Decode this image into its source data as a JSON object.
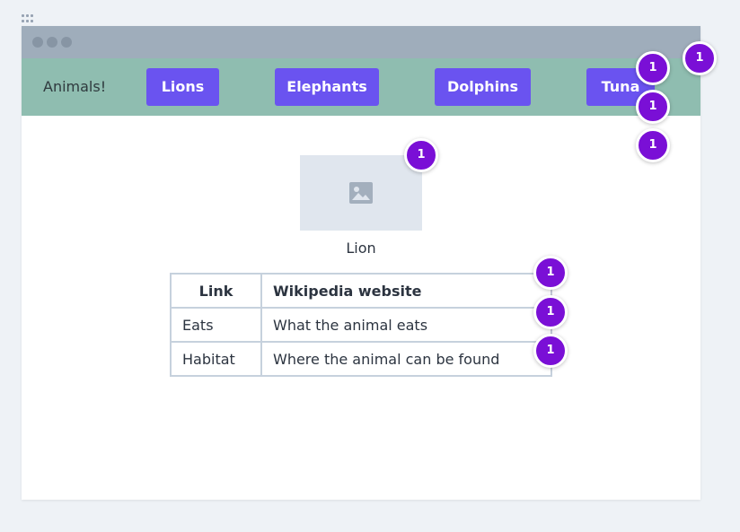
{
  "window": {
    "title": ""
  },
  "nav": {
    "brand": "Animals!",
    "buttons": [
      {
        "label": "Lions"
      },
      {
        "label": "Elephants"
      },
      {
        "label": "Dolphins"
      },
      {
        "label": "Tuna"
      }
    ]
  },
  "main": {
    "image_icon": "image-icon",
    "caption": "Lion",
    "table": {
      "headers": [
        "Link",
        "Wikipedia website"
      ],
      "rows": [
        [
          "Eats",
          "What the animal eats"
        ],
        [
          "Habitat",
          "Where the animal can be found"
        ]
      ]
    }
  },
  "badges": [
    "1",
    "1",
    "1",
    "1",
    "1",
    "1",
    "1",
    "1"
  ],
  "colors": {
    "accent": "#6a53f0",
    "navbar": "#8fbdb0",
    "titlebar": "#9fadbb",
    "badge": "#7a0fd6"
  }
}
